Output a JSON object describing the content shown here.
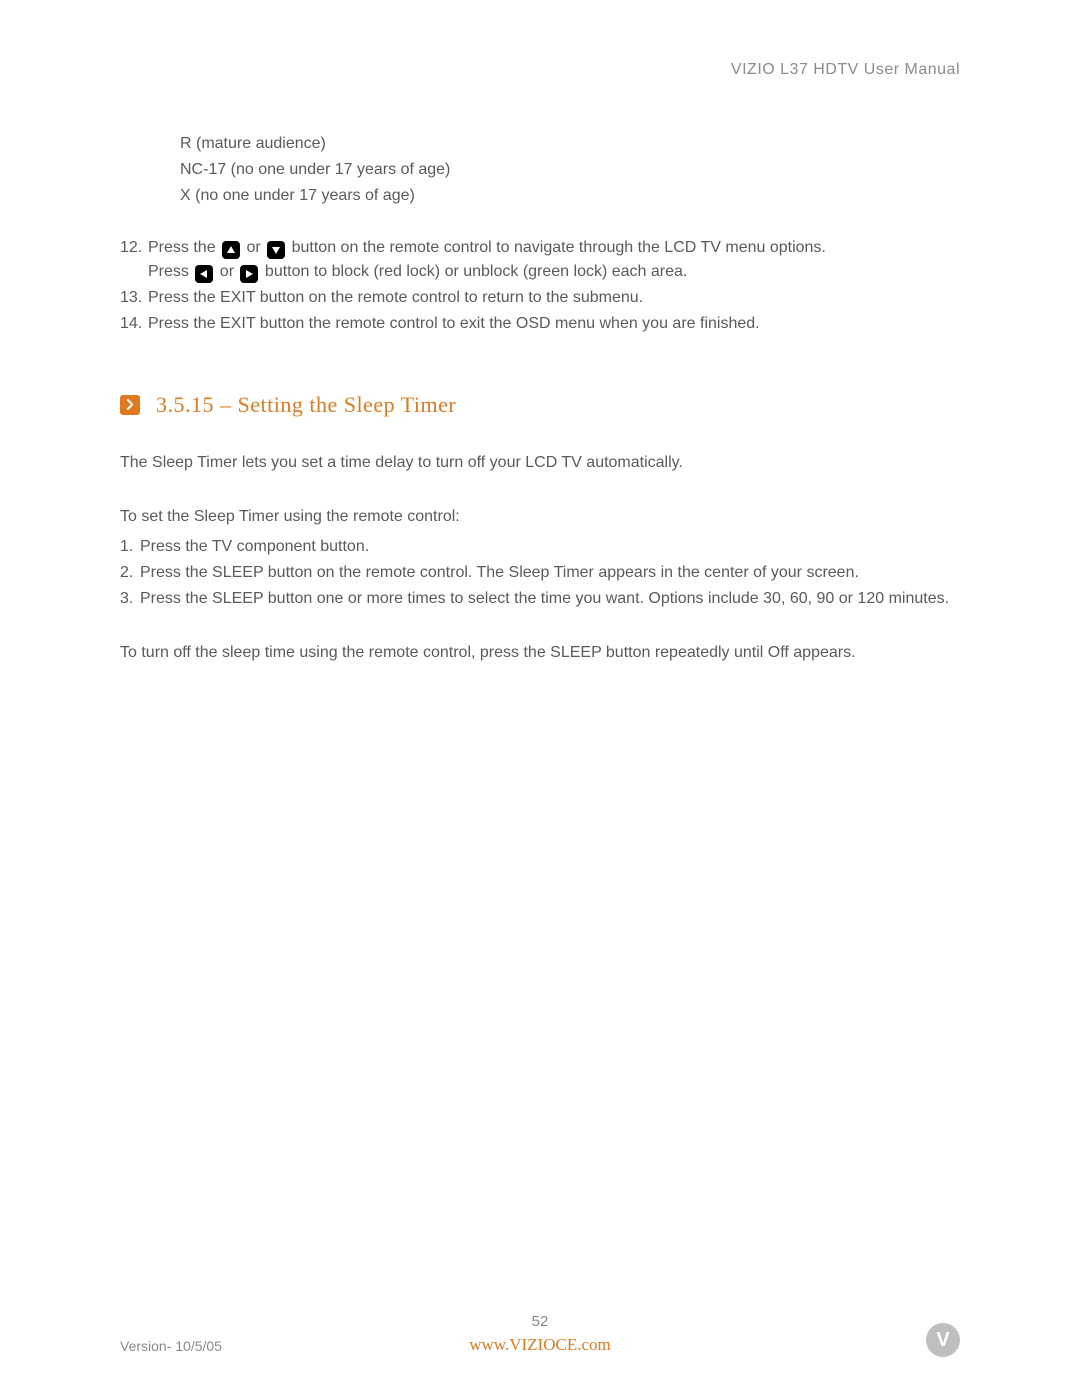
{
  "header": {
    "title": "VIZIO L37 HDTV User Manual"
  },
  "ratings": [
    "R (mature audience)",
    "NC-17 (no one under 17 years of age)",
    "X (no one under 17 years of age)"
  ],
  "list_a": [
    {
      "n": "12.",
      "pre": "Press the ",
      "mid": " or ",
      "post": " button on the remote control to navigate through the LCD TV menu options.",
      "line2_pre": "Press  ",
      "line2_mid": " or ",
      "line2_post": "  button to block (red lock) or unblock (green lock) each area."
    },
    {
      "n": "13.",
      "text": "Press the EXIT button on the remote control to return to the submenu."
    },
    {
      "n": "14.",
      "text": "Press the EXIT button the remote control to exit the OSD menu when you are finished."
    }
  ],
  "section": {
    "title": "3.5.15 – Setting the Sleep Timer"
  },
  "p1": "The Sleep Timer lets you set a time delay to turn off your LCD TV automatically.",
  "p2": "To set the Sleep Timer using the remote control:",
  "ol": [
    "Press the TV component button.",
    "Press the SLEEP button on the remote control. The Sleep Timer appears in the center of your screen.",
    "Press the SLEEP button one or more times to select the time you want.  Options include 30, 60, 90 or 120 minutes."
  ],
  "p3": "To turn off the sleep time using the remote control, press the SLEEP button repeatedly until Off appears.",
  "footer": {
    "version": "Version- 10/5/05",
    "page": "52",
    "url": "www.VIZIOCE.com",
    "badge": "V"
  }
}
